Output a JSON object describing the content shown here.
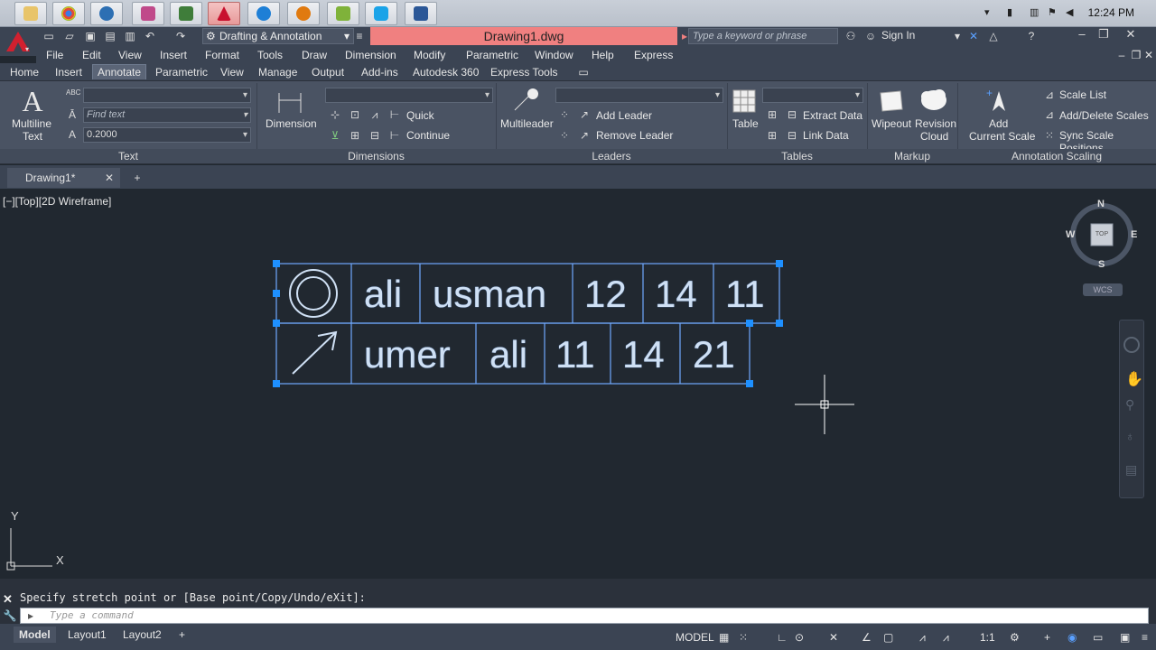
{
  "taskbar": {
    "icons": [
      "file-explorer",
      "chrome",
      "app-blue",
      "app-pink",
      "app-green",
      "autocad",
      "internet-explorer",
      "app-orange",
      "app-lime",
      "skype",
      "word"
    ],
    "clock": "12:24 PM"
  },
  "title": {
    "workspace": "Drafting & Annotation",
    "document": "Drawing1.dwg",
    "search_placeholder": "Type a keyword or phrase",
    "signin": "Sign In"
  },
  "menu": [
    "File",
    "Edit",
    "View",
    "Insert",
    "Format",
    "Tools",
    "Draw",
    "Dimension",
    "Modify",
    "Parametric",
    "Window",
    "Help",
    "Express"
  ],
  "ribbon_tabs": [
    "Home",
    "Insert",
    "Annotate",
    "Parametric",
    "View",
    "Manage",
    "Output",
    "Add-ins",
    "Autodesk 360",
    "Express Tools"
  ],
  "active_tab": "Annotate",
  "ribbon": {
    "text_panel": {
      "multiline_label_1": "Multiline",
      "multiline_label_2": "Text",
      "find_placeholder": "Find text",
      "height_value": "0.2000",
      "title": "Text"
    },
    "dimensions_panel": {
      "dimension_label": "Dimension",
      "quick_label": "Quick",
      "continue_label": "Continue",
      "title": "Dimensions"
    },
    "leaders_panel": {
      "multileader_label": "Multileader",
      "add_leader": "Add Leader",
      "remove_leader": "Remove Leader",
      "title": "Leaders"
    },
    "tables_panel": {
      "table_label": "Table",
      "extract_data": "Extract Data",
      "link_data": "Link Data",
      "title": "Tables"
    },
    "markup_panel": {
      "wipeout_label": "Wipeout",
      "revision_label_1": "Revision",
      "revision_label_2": "Cloud",
      "title": "Markup"
    },
    "scaling_panel": {
      "add_label_1": "Add",
      "add_label_2": "Current Scale",
      "scale_list": "Scale List",
      "add_delete_scales": "Add/Delete Scales",
      "sync_scale_positions": "Sync Scale Positions",
      "title": "Annotation Scaling"
    }
  },
  "file_tab": "Drawing1*",
  "viewport_label": "[−][Top][2D Wireframe]",
  "viewcube": {
    "n": "N",
    "s": "S",
    "e": "E",
    "w": "W",
    "face": "TOP",
    "wcs": "WCS"
  },
  "table": {
    "row1": [
      "ali",
      "usman",
      "12",
      "14",
      "11"
    ],
    "row2": [
      "umer",
      "ali",
      "11",
      "14",
      "21"
    ]
  },
  "ucs": {
    "x": "X",
    "y": "Y"
  },
  "command": {
    "history": "Specify stretch point or [Base point/Copy/Undo/eXit]:",
    "placeholder": "Type a command"
  },
  "layout_tabs": [
    "Model",
    "Layout1",
    "Layout2"
  ],
  "status": {
    "model": "MODEL",
    "scale": "1:1"
  },
  "colors": {
    "accent": "#f08080",
    "selection": "#1e90ff",
    "table_line": "#6fa8ff"
  }
}
